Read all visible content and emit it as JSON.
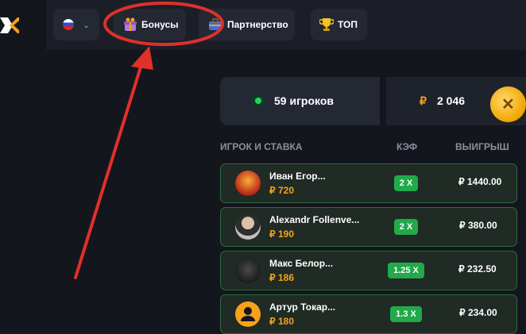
{
  "header": {
    "language": {
      "flag": "russia-flag",
      "chevron": "chevron-down-icon"
    },
    "nav": [
      {
        "label": "Бонусы",
        "icon": "gift-icon"
      },
      {
        "label": "Партнерство",
        "icon": "briefcase-icon"
      },
      {
        "label": "ТОП",
        "icon": "trophy-icon"
      }
    ]
  },
  "stats": {
    "players": "59 игроков",
    "bank_currency": "₽",
    "bank": "2 046"
  },
  "table": {
    "headers": [
      "ИГРОК И СТАВКА",
      "КЭФ",
      "ВЫИГРЫШ"
    ],
    "rows": [
      {
        "name": "Иван Егор...",
        "bet": "₽ 720",
        "coef": "2 X",
        "win": "₽ 1440.00",
        "avatar": "orange-photo"
      },
      {
        "name": "Alexandr Follenve...",
        "bet": "₽ 190",
        "coef": "2 X",
        "win": "₽ 380.00",
        "avatar": "person-photo"
      },
      {
        "name": "Макс Белор...",
        "bet": "₽ 186",
        "coef": "1.25 X",
        "win": "₽ 232.50",
        "avatar": "dark-photo"
      },
      {
        "name": "Артур Токар...",
        "bet": "₽ 180",
        "coef": "1.3 X",
        "win": "₽ 234.00",
        "avatar": "default-user-icon"
      }
    ]
  },
  "colors": {
    "accent_orange": "#f7a21b",
    "coef_green": "#21a94a",
    "row_border": "#2d6a41",
    "annotation_red": "#e0302a"
  }
}
